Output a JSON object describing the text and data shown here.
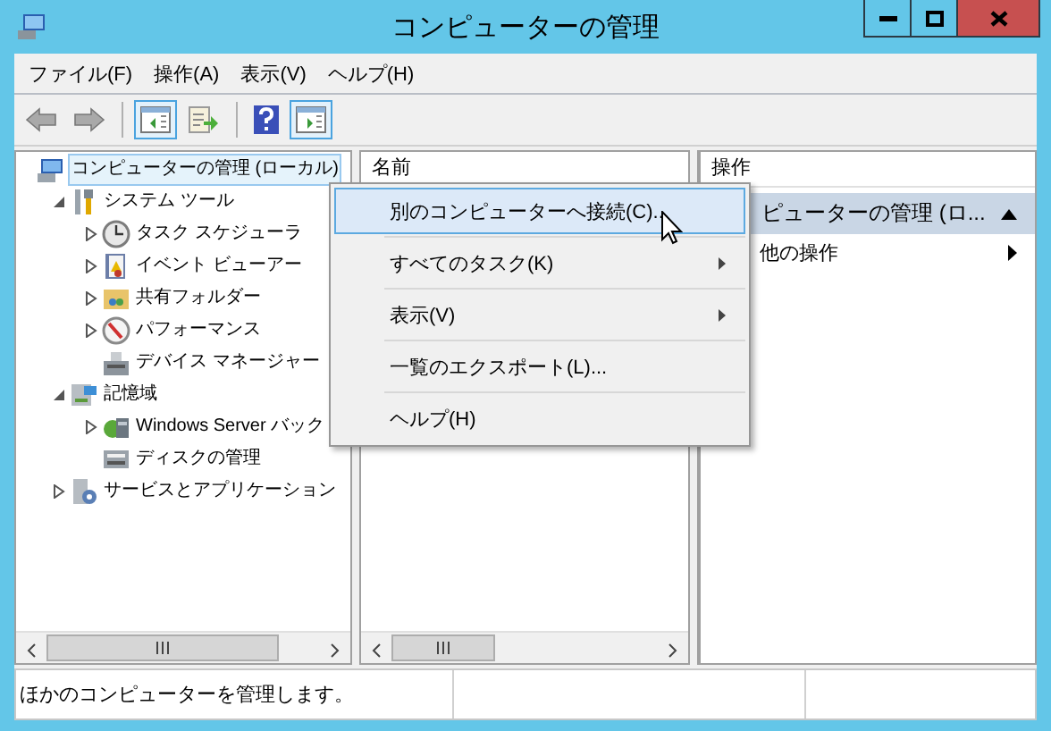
{
  "window": {
    "title": "コンピューターの管理"
  },
  "menu_bar": [
    "ファイル(F)",
    "操作(A)",
    "表示(V)",
    "ヘルプ(H)"
  ],
  "toolbar": [
    {
      "kind": "back",
      "disabled": true
    },
    {
      "kind": "forward",
      "disabled": true
    },
    {
      "kind": "separator"
    },
    {
      "kind": "console-tree",
      "on": true
    },
    {
      "kind": "export",
      "on": false
    },
    {
      "kind": "separator"
    },
    {
      "kind": "help",
      "on": false
    },
    {
      "kind": "action-pane",
      "on": true
    }
  ],
  "tree": [
    {
      "label": "コンピューターの管理 (ローカル)",
      "kind": "computer",
      "selected": true,
      "children": [
        {
          "label": "システム ツール",
          "kind": "tools",
          "selected": false,
          "expanded": true,
          "children": [
            {
              "label": "タスク スケジューラ",
              "kind": "clock",
              "selected": false,
              "expanded": false,
              "expandable": true
            },
            {
              "label": "イベント ビューアー",
              "kind": "log",
              "selected": false,
              "expanded": false,
              "expandable": true
            },
            {
              "label": "共有フォルダー",
              "kind": "folder",
              "selected": false,
              "expanded": false,
              "expandable": true
            },
            {
              "label": "パフォーマンス",
              "kind": "gauge",
              "selected": false,
              "expanded": false,
              "expandable": true
            },
            {
              "label": "デバイス マネージャー",
              "kind": "device",
              "selected": false,
              "expandable": false
            }
          ]
        },
        {
          "label": "記憶域",
          "kind": "storage",
          "selected": false,
          "expanded": true,
          "children": [
            {
              "label": "Windows Server バック",
              "kind": "backup",
              "selected": false,
              "expanded": false,
              "expandable": true
            },
            {
              "label": "ディスクの管理",
              "kind": "disk",
              "selected": false,
              "expandable": false
            }
          ]
        },
        {
          "label": "サービスとアプリケーション",
          "kind": "services",
          "selected": false,
          "expanded": false,
          "expandable": true
        }
      ]
    }
  ],
  "center_pane": {
    "column_header": "名前"
  },
  "action_pane": {
    "header": "操作",
    "section_title": "ピューターの管理 (ロ...",
    "section_expanded": true,
    "items": [
      {
        "label": "他の操作",
        "submenu": true
      }
    ]
  },
  "context_menu": [
    {
      "label": "別のコンピューターへ接続(C)...",
      "selected": true,
      "submenu": false
    },
    {
      "label": "すべてのタスク(K)",
      "selected": false,
      "submenu": true
    },
    {
      "label": "表示(V)",
      "selected": false,
      "submenu": true
    },
    {
      "label": "一覧のエクスポート(L)...",
      "selected": false,
      "submenu": false
    },
    {
      "label": "ヘルプ(H)",
      "selected": false,
      "submenu": false
    }
  ],
  "status_bar": [
    "ほかのコンピューターを管理します。"
  ]
}
